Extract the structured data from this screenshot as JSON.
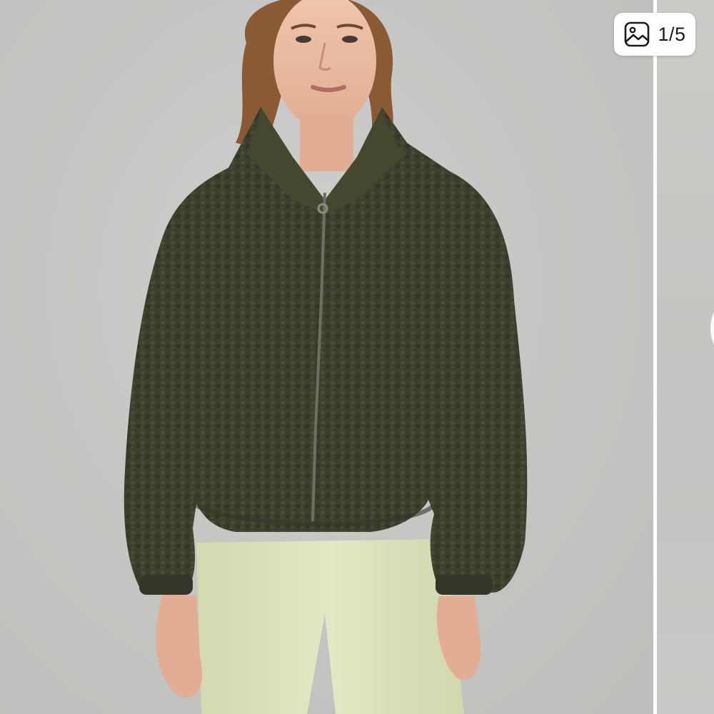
{
  "gallery": {
    "counter": "1/5",
    "current_index": 1,
    "total_images": 5,
    "counter_icon": "gallery-image-icon"
  },
  "colors": {
    "jacket": "#3d3f2c",
    "pants": "#dfe3bd",
    "background": "#c6c7c4",
    "badge": "#ffffff"
  }
}
